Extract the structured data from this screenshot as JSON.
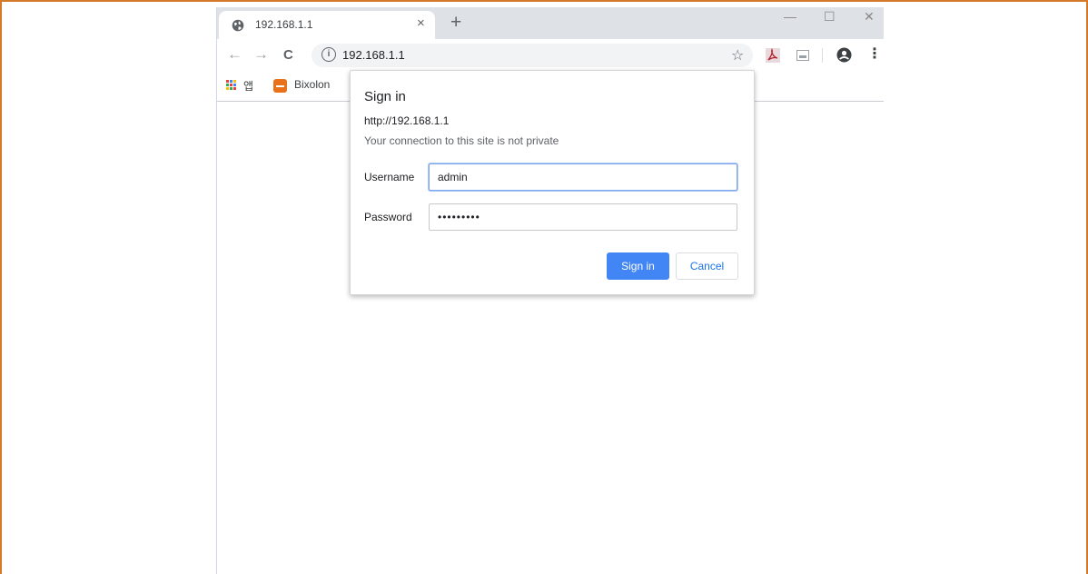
{
  "browser": {
    "tab": {
      "title": "192.168.1.1",
      "close": "×",
      "favicon": "globe-icon"
    },
    "new_tab": "+",
    "window_controls": {
      "minimize": "—",
      "maximize": "☐",
      "close": "✕"
    },
    "toolbar": {
      "back": "←",
      "forward": "→",
      "reload": "C",
      "url": "192.168.1.1",
      "info_icon": "i",
      "star": "☆",
      "menu": "⋮"
    },
    "bookmarks": {
      "apps_label": "앱",
      "items": [
        {
          "label": "Bixolon",
          "icon": "bixolon-favicon"
        }
      ]
    }
  },
  "dialog": {
    "title": "Sign in",
    "host": "http://192.168.1.1",
    "warning": "Your connection to this site is not private",
    "username": {
      "label": "Username",
      "value": "admin"
    },
    "password": {
      "label": "Password",
      "value": "•••••••••"
    },
    "sign_in": "Sign in",
    "cancel": "Cancel"
  },
  "colors": {
    "accent": "#4285f4",
    "frame": "#d4782a",
    "bookmark_favicon": "#e8711a"
  }
}
